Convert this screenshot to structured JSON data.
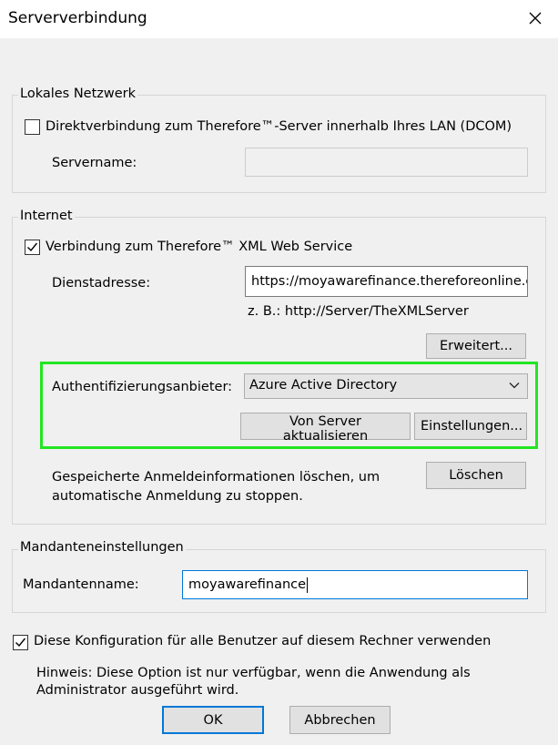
{
  "window": {
    "title": "Serververbindung",
    "close_icon": "close-icon"
  },
  "local_network": {
    "legend": "Lokales Netzwerk",
    "checkbox_label": "Direktverbindung zum Therefore™-Server innerhalb Ihres LAN (DCOM)",
    "checked": false,
    "servername_label": "Servername:",
    "servername_value": ""
  },
  "internet": {
    "legend": "Internet",
    "checkbox_label": "Verbindung zum Therefore™ XML Web Service",
    "checked": true,
    "service_address_label": "Dienstadresse:",
    "service_address_value": "https://moyawarefinance.thereforeonline.c",
    "example_text": "z. B.: http://Server/TheXMLServer",
    "advanced_button": "Erweitert...",
    "auth_provider_label": "Authentifizierungsanbieter:",
    "auth_provider_value": "Azure Active Directory",
    "update_from_server_button": "Von Server aktualisieren",
    "settings_button": "Einstellungen...",
    "clear_credentials_text_line1": "Gespeicherte Anmeldeinformationen löschen, um",
    "clear_credentials_text_line2": "automatische Anmeldung zu stoppen.",
    "delete_button": "Löschen"
  },
  "tenant": {
    "legend": "Mandanteneinstellungen",
    "name_label": "Mandantenname:",
    "name_value": "moyawarefinance"
  },
  "all_users": {
    "checkbox_label": "Diese Konfiguration für alle Benutzer auf diesem Rechner verwenden",
    "checked": true,
    "hint_line1": "Hinweis: Diese Option ist nur verfügbar, wenn die Anwendung als",
    "hint_line2": "Administrator ausgeführt wird."
  },
  "footer": {
    "ok_button": "OK",
    "cancel_button": "Abbrechen"
  },
  "colors": {
    "highlight": "#22e622",
    "focus_border": "#0078d7"
  }
}
